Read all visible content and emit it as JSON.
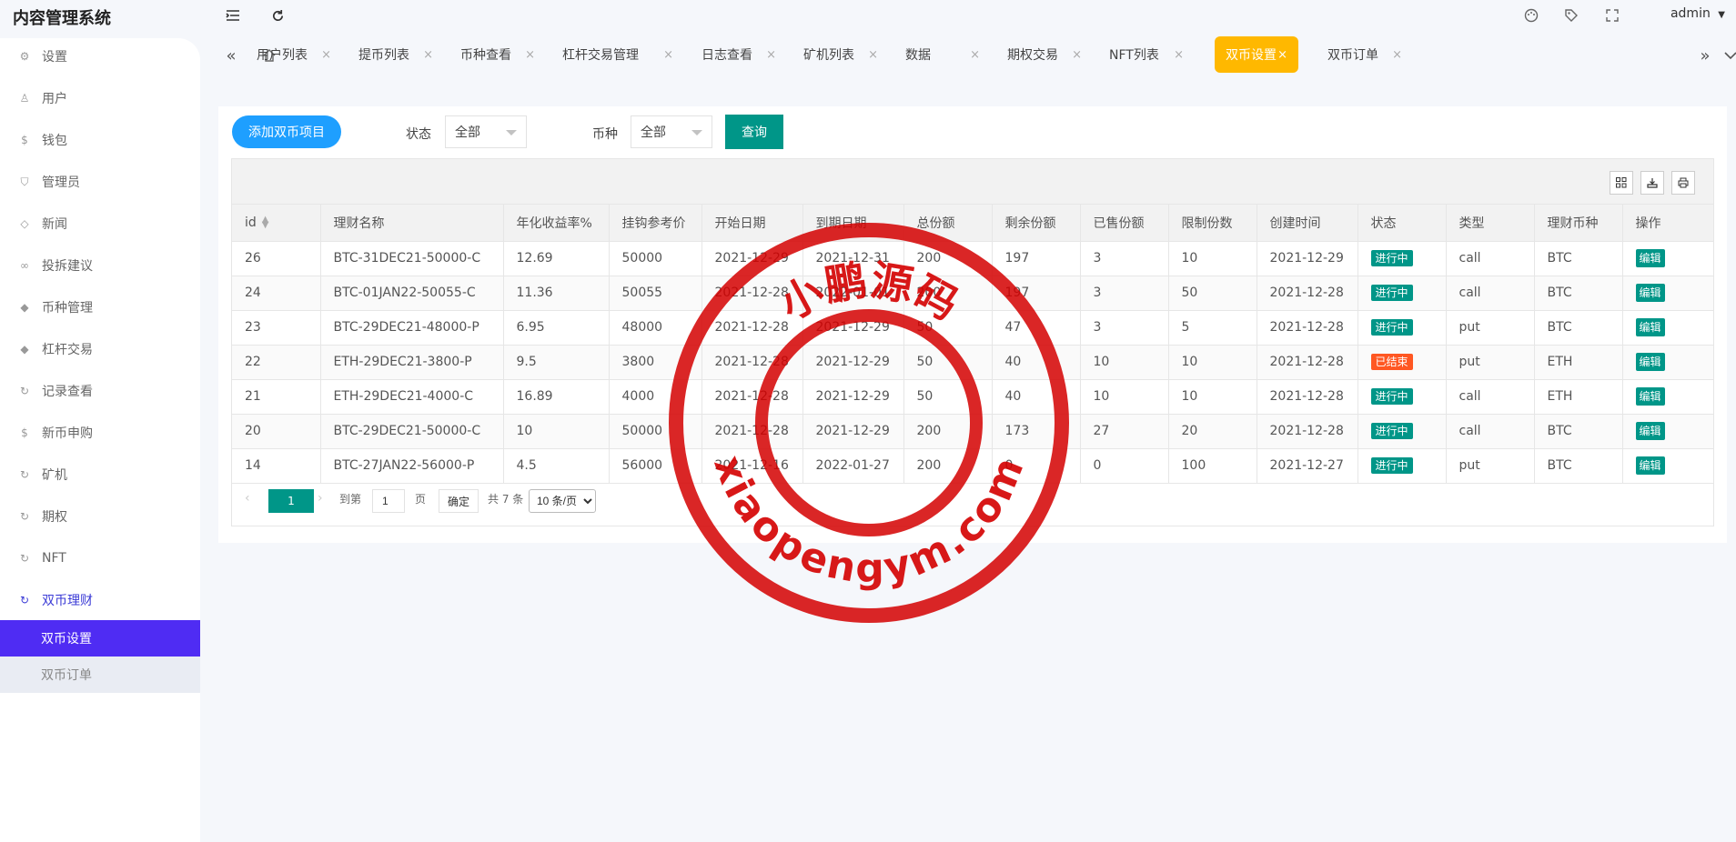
{
  "app": {
    "title": "内容管理系统"
  },
  "topbar": {
    "user": "admin"
  },
  "sidebar": {
    "items": [
      {
        "label": "设置",
        "icon": "gear-icon"
      },
      {
        "label": "用户",
        "icon": "user-icon"
      },
      {
        "label": "钱包",
        "icon": "dollar-icon"
      },
      {
        "label": "管理员",
        "icon": "shield-icon"
      },
      {
        "label": "新闻",
        "icon": "tag-icon"
      },
      {
        "label": "投拆建议",
        "icon": "link-icon"
      },
      {
        "label": "币种管理",
        "icon": "diamond-icon"
      },
      {
        "label": "杠杆交易",
        "icon": "diamond-icon"
      },
      {
        "label": "记录查看",
        "icon": "circle-arrow-icon"
      },
      {
        "label": "新币申购",
        "icon": "dollar-icon"
      },
      {
        "label": "矿机",
        "icon": "circle-arrow-icon"
      },
      {
        "label": "期权",
        "icon": "circle-arrow-icon"
      },
      {
        "label": "NFT",
        "icon": "circle-arrow-icon"
      },
      {
        "label": "双币理财",
        "icon": "circle-arrow-icon"
      }
    ],
    "subitems": [
      {
        "label": "双币设置",
        "active": true
      },
      {
        "label": "双币订单",
        "active": false
      }
    ]
  },
  "tabs": [
    {
      "label": "用户列表"
    },
    {
      "label": "提币列表"
    },
    {
      "label": "币种查看"
    },
    {
      "label": "杠杆交易管理"
    },
    {
      "label": "日志查看"
    },
    {
      "label": "矿机列表"
    },
    {
      "label": "数据"
    },
    {
      "label": "期权交易"
    },
    {
      "label": "NFT列表"
    },
    {
      "label": "双币设置",
      "active": true
    },
    {
      "label": "双币订单"
    }
  ],
  "tab_close_glyph": "×",
  "toolbar": {
    "add_label": "添加双币项目",
    "status_label": "状态",
    "status_value": "全部",
    "coin_label": "币种",
    "coin_value": "全部",
    "query_label": "查询"
  },
  "table": {
    "columns": [
      "id",
      "理财名称",
      "年化收益率%",
      "挂钩参考价",
      "开始日期",
      "到期日期",
      "总份额",
      "剩余份额",
      "已售份额",
      "限制份数",
      "创建时间",
      "状态",
      "类型",
      "理财币种",
      "操作"
    ],
    "rows": [
      [
        "26",
        "BTC-31DEC21-50000-C",
        "12.69",
        "50000",
        "2021-12-29",
        "2021-12-31",
        "200",
        "197",
        "3",
        "10",
        "2021-12-29",
        "进行中",
        "call",
        "BTC",
        "编辑"
      ],
      [
        "24",
        "BTC-01JAN22-50055-C",
        "11.36",
        "50055",
        "2021-12-28",
        "2022-01-01",
        "200",
        "197",
        "3",
        "50",
        "2021-12-28",
        "进行中",
        "call",
        "BTC",
        "编辑"
      ],
      [
        "23",
        "BTC-29DEC21-48000-P",
        "6.95",
        "48000",
        "2021-12-28",
        "2021-12-29",
        "50",
        "47",
        "3",
        "5",
        "2021-12-28",
        "进行中",
        "put",
        "BTC",
        "编辑"
      ],
      [
        "22",
        "ETH-29DEC21-3800-P",
        "9.5",
        "3800",
        "2021-12-28",
        "2021-12-29",
        "50",
        "40",
        "10",
        "10",
        "2021-12-28",
        "已结束",
        "put",
        "ETH",
        "编辑"
      ],
      [
        "21",
        "ETH-29DEC21-4000-C",
        "16.89",
        "4000",
        "2021-12-28",
        "2021-12-29",
        "50",
        "40",
        "10",
        "10",
        "2021-12-28",
        "进行中",
        "call",
        "ETH",
        "编辑"
      ],
      [
        "20",
        "BTC-29DEC21-50000-C",
        "10",
        "50000",
        "2021-12-28",
        "2021-12-29",
        "200",
        "173",
        "27",
        "20",
        "2021-12-28",
        "进行中",
        "call",
        "BTC",
        "编辑"
      ],
      [
        "14",
        "BTC-27JAN22-56000-P",
        "4.5",
        "56000",
        "2021-12-16",
        "2022-01-27",
        "200",
        "0",
        "0",
        "100",
        "2021-12-27",
        "进行中",
        "put",
        "BTC",
        "编辑"
      ]
    ]
  },
  "pager": {
    "current": "1",
    "goto_label": "到第",
    "goto_value": "1",
    "page_unit": "页",
    "confirm_label": "确定",
    "total_label": "共 7 条",
    "page_size": "10 条/页"
  },
  "watermark": {
    "top_text": "小鹏源码",
    "bottom_text": "xiaopengym.com",
    "color": "#d40000"
  },
  "colors": {
    "accent": "#4f2cf3",
    "active_tab": "#ffb800",
    "primary_btn": "#1e9fff",
    "teal": "#009688",
    "ended": "#ff5722"
  }
}
